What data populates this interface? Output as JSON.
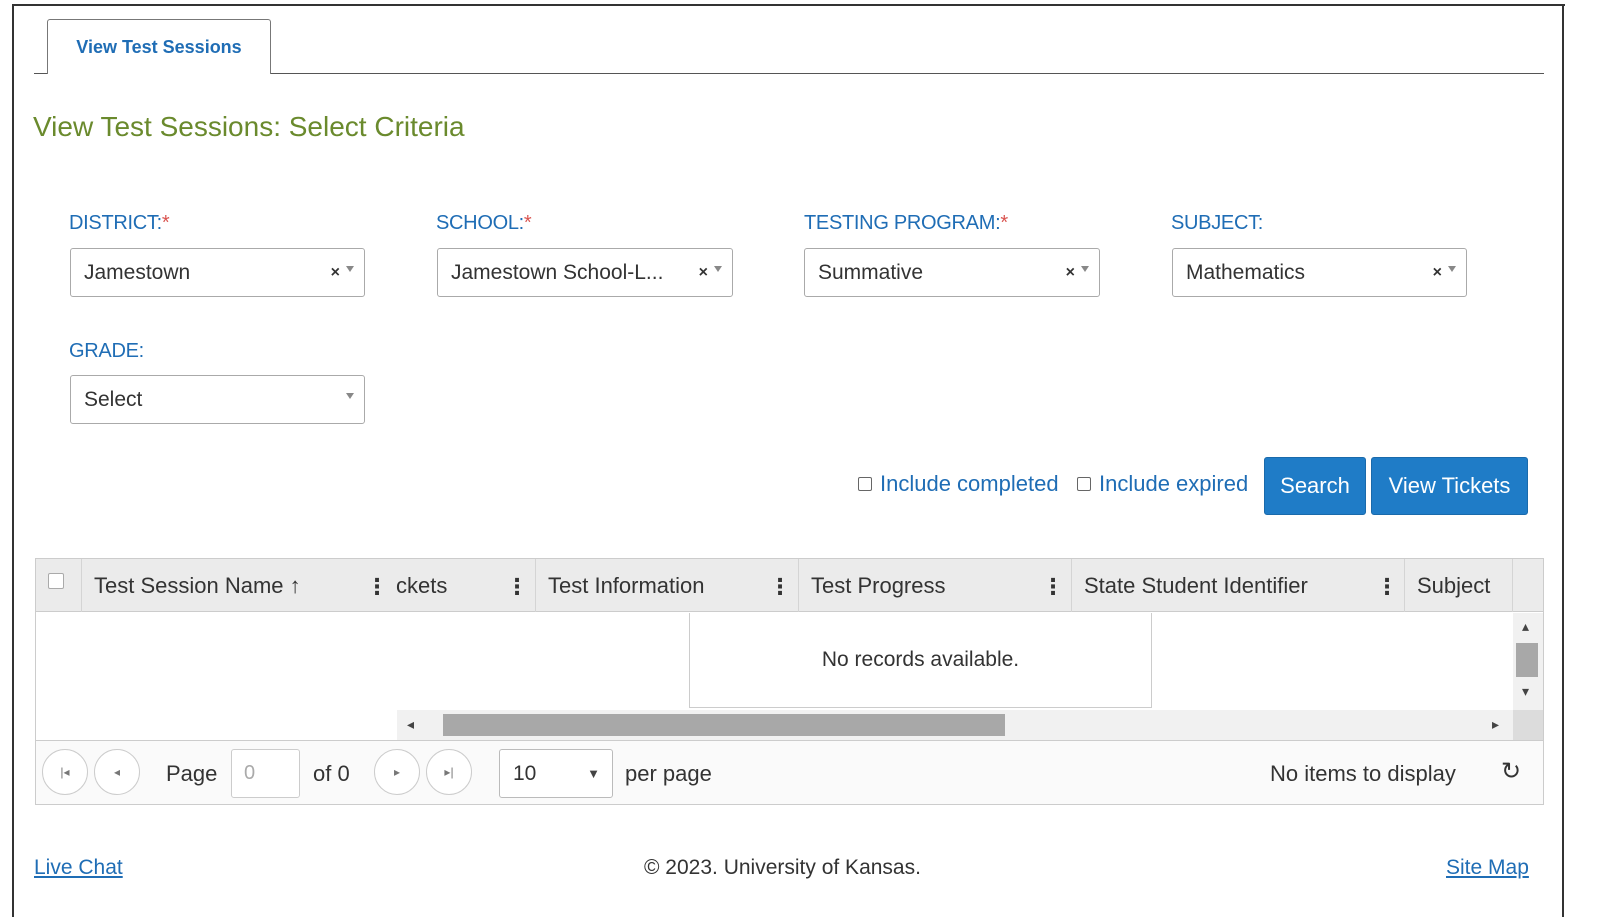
{
  "tab": {
    "label": "View Test Sessions"
  },
  "page_title": "View Test Sessions: Select Criteria",
  "filters": {
    "district": {
      "label": "DISTRICT:",
      "required": "*",
      "value": "Jamestown"
    },
    "school": {
      "label": "SCHOOL:",
      "required": "*",
      "value": "Jamestown School-L..."
    },
    "testing_program": {
      "label": "TESTING PROGRAM:",
      "required": "*",
      "value": "Summative"
    },
    "subject": {
      "label": "SUBJECT:",
      "value": "Mathematics"
    },
    "grade": {
      "label": "GRADE:",
      "value": "Select"
    }
  },
  "options": {
    "include_completed": "Include completed",
    "include_expired": "Include expired",
    "search_button": "Search",
    "view_tickets_button": "View Tickets"
  },
  "grid": {
    "columns": [
      "Test Session Name ↑",
      "ckets",
      "Test Information",
      "Test Progress",
      "State Student Identifier",
      "Subject"
    ],
    "empty_message": "No records available."
  },
  "pager": {
    "page_label": "Page",
    "page_value": "0",
    "of_label": "of 0",
    "page_size": "10",
    "per_page_label": "per page",
    "status": "No items to display"
  },
  "footer": {
    "live_chat": "Live Chat",
    "copyright": "© 2023. University of Kansas.",
    "site_map": "Site Map"
  },
  "colors": {
    "accent": "#1f7cc7",
    "title": "#6a8a2d",
    "label": "#1f6db5",
    "required": "#d9534f"
  },
  "icons": [
    "clear-icon",
    "dropdown-arrow-icon",
    "first-page-icon",
    "prev-page-icon",
    "next-page-icon",
    "last-page-icon",
    "refresh-icon",
    "sort-asc-icon",
    "column-menu-icon"
  ]
}
